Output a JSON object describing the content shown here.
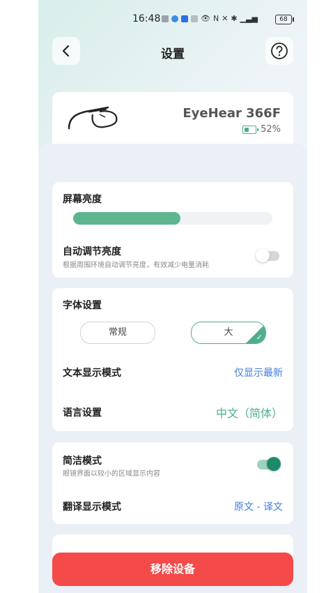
{
  "status_bar": {
    "time": "16:48",
    "battery": "68"
  },
  "header": {
    "title": "设置"
  },
  "device": {
    "name": "EyeHear 366F",
    "battery": "52%"
  },
  "brightness": {
    "label": "屏幕亮度",
    "level": 0.54,
    "auto_label": "自动调节亮度",
    "auto_desc": "根据周围环境自动调节亮度，有效减少电量消耗",
    "auto_enabled": false
  },
  "font": {
    "label": "字体设置",
    "options": [
      "常规",
      "大"
    ],
    "selected": "大",
    "text_mode_label": "文本显示模式",
    "text_mode_value": "仅显示最新",
    "language_label": "语言设置",
    "language_value": "中文（简体）"
  },
  "concise": {
    "label": "简洁模式",
    "desc": "眼镜界面以较小的区域显示内容",
    "enabled": true,
    "translate_label": "翻译显示模式",
    "translate_value": "原文 - 译文"
  },
  "actions": {
    "remove_label": "移除设备"
  },
  "colors": {
    "accent": "#4fae8e",
    "slider_fill": "#5db58f",
    "link_blue": "#3e7ed6",
    "danger": "#f44a4a",
    "toggle_on": "#1f8a6b"
  }
}
